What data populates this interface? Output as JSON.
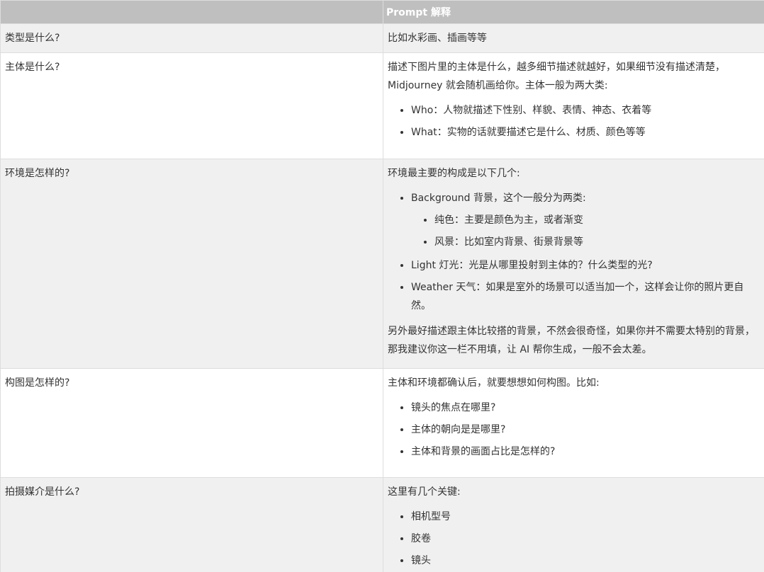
{
  "table": {
    "header": {
      "col1": "",
      "col2": "Prompt 解释"
    },
    "rows": [
      {
        "question": "类型是什么?",
        "intro": "比如水彩画、插画等等"
      },
      {
        "question": "主体是什么?",
        "intro": "描述下图片里的主体是什么，越多细节描述就越好，如果细节没有描述清楚，Midjourney 就会随机画给你。主体一般为两大类:",
        "items": [
          "Who：人物就描述下性别、样貌、表情、神态、衣着等",
          "What：实物的话就要描述它是什么、材质、颜色等等"
        ]
      },
      {
        "question": "环境是怎样的?",
        "intro": "环境最主要的构成是以下几个:",
        "items": [
          "Background 背景，这个一般分为两类:",
          "Light 灯光：光是从哪里投射到主体的？什么类型的光?",
          "Weather 天气：如果是室外的场景可以适当加一个，这样会让你的照片更自然。"
        ],
        "subitems": [
          "纯色：主要是颜色为主，或者渐变",
          "风景：比如室内背景、街景背景等"
        ],
        "outro": "另外最好描述跟主体比较搭的背景，不然会很奇怪，如果你并不需要太特别的背景，那我建议你这一栏不用填，让 AI 帮你生成，一般不会太差。"
      },
      {
        "question": "构图是怎样的?",
        "intro": "主体和环境都确认后，就要想想如何构图。比如:",
        "items": [
          "镜头的焦点在哪里?",
          "主体的朝向是是哪里?",
          "主体和背景的画面占比是怎样的?"
        ]
      },
      {
        "question": "拍摄媒介是什么?",
        "intro": "这里有几个关键:",
        "items": [
          "相机型号",
          "胶卷",
          "镜头"
        ]
      }
    ]
  }
}
